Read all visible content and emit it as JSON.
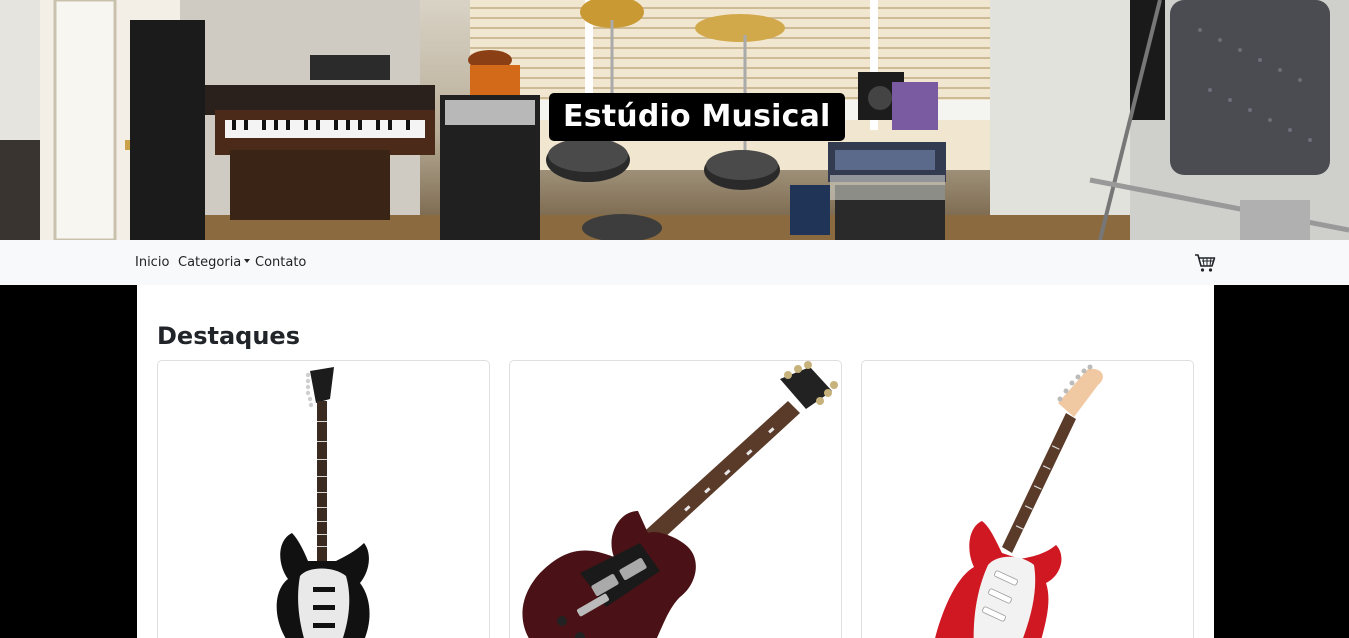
{
  "hero": {
    "title": "Estúdio Musical",
    "image": "home music studio photo with keyboards, drum kit, cymbals and microphone"
  },
  "navbar": {
    "items": [
      {
        "label": "Inicio"
      },
      {
        "label": "Categoria",
        "has_dropdown": true
      },
      {
        "label": "Contato"
      }
    ],
    "cart_icon": "shopping-cart-icon"
  },
  "main": {
    "section_title": "Destaques",
    "products": [
      {
        "image": "black stratocaster-style electric guitar"
      },
      {
        "image": "cherry SG-style electric guitar"
      },
      {
        "image": "red stratocaster-style electric guitar"
      }
    ]
  },
  "colors": {
    "navbar_bg": "#f8f9fa",
    "page_bg": "#000000",
    "content_bg": "#ffffff",
    "title_badge_bg": "#000000"
  }
}
